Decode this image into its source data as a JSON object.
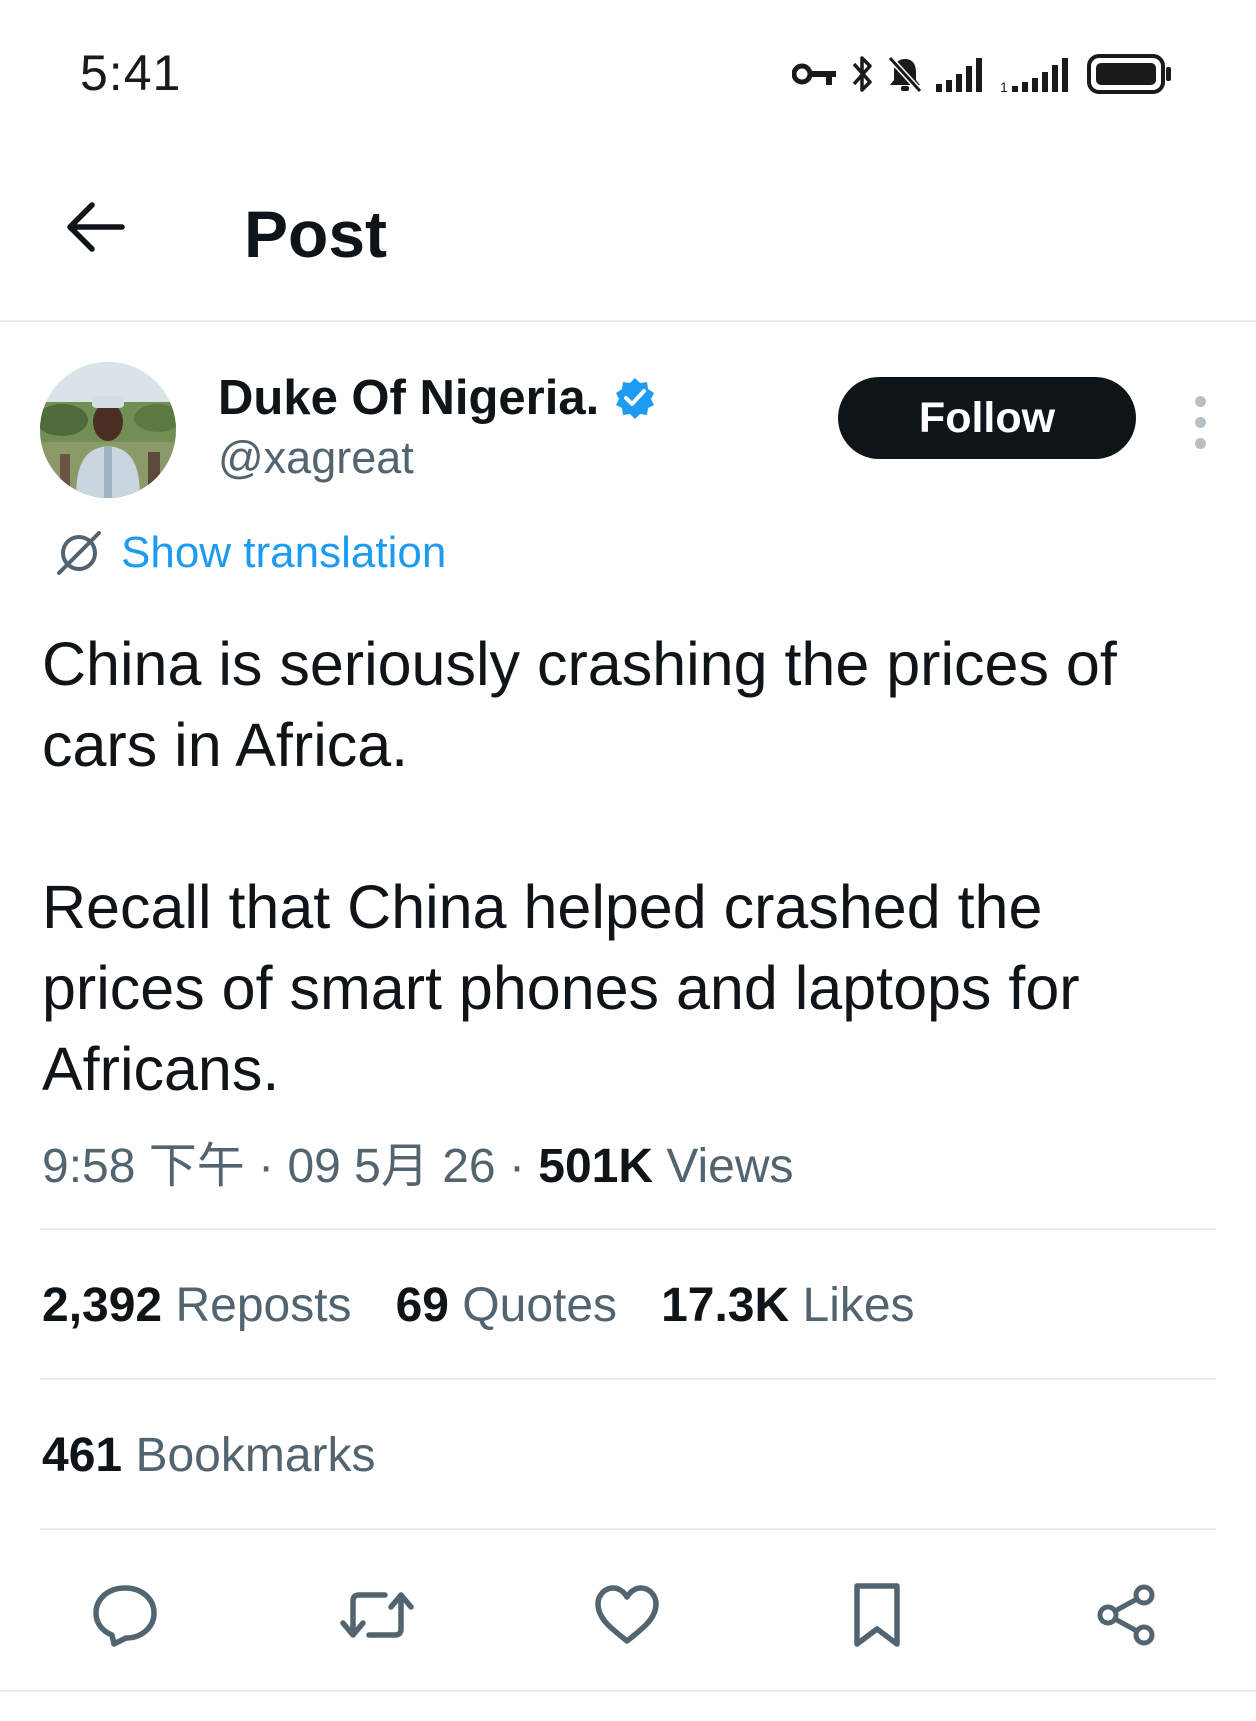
{
  "status_bar": {
    "time": "5:41",
    "icons": [
      "vpn-key-icon",
      "bluetooth-icon",
      "bell-muted-icon",
      "signal-icon",
      "signal-icon",
      "battery-icon"
    ]
  },
  "header": {
    "title": "Post",
    "back_icon": "arrow-left-icon"
  },
  "author": {
    "name": "Duke Of Nigeria.",
    "handle": "@xagreat",
    "verified": true,
    "follow_label": "Follow",
    "more_icon": "more-vertical-icon"
  },
  "translation": {
    "label": "Show translation",
    "icon": "translate-icon"
  },
  "post": {
    "paragraphs": [
      "China is seriously crashing the prices of cars in Africa.",
      "Recall that China helped crashed the prices of smart phones and laptops for Africans."
    ]
  },
  "meta": {
    "time": "9:58 下午",
    "sep": "·",
    "date": "09 5月 26",
    "views_count": "501K",
    "views_label": "Views"
  },
  "stats": {
    "reposts_count": "2,392",
    "reposts_label": "Reposts",
    "quotes_count": "69",
    "quotes_label": "Quotes",
    "likes_count": "17.3K",
    "likes_label": "Likes",
    "bookmarks_count": "461",
    "bookmarks_label": "Bookmarks"
  },
  "actions": [
    "reply-icon",
    "repost-icon",
    "like-icon",
    "bookmark-icon",
    "share-icon"
  ],
  "colors": {
    "text": "#0f1419",
    "secondary": "#536471",
    "link": "#1d9bf0",
    "verified": "#1d9bf0",
    "follow_bg": "#0f1419",
    "divider": "#e6e9eb"
  }
}
